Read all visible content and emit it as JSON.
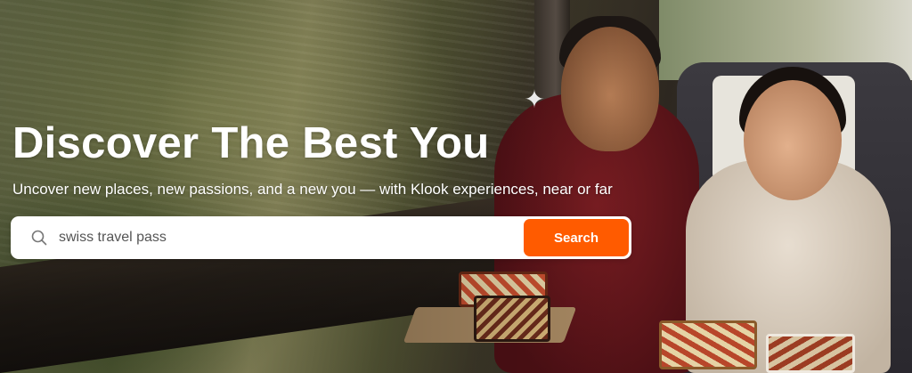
{
  "hero": {
    "headline": "Discover The Best You",
    "subtitle": "Uncover new places, new passions, and a new you — with Klook experiences, near or far",
    "background_image": "travel-couple-train-bento-photo"
  },
  "search": {
    "placeholder": "swiss travel pass",
    "icon": "search-icon",
    "button_label": "Search"
  },
  "colors": {
    "accent": "#ff5b00",
    "headline_text": "#ffffff",
    "search_bg": "#ffffff"
  }
}
